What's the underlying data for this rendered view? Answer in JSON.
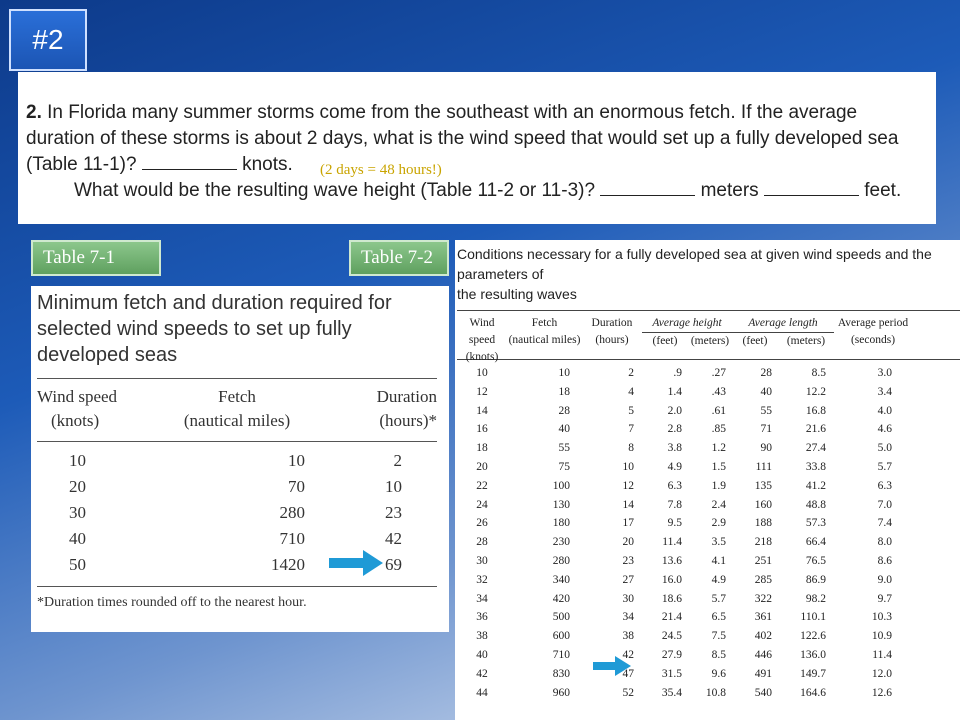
{
  "slide": {
    "number_label": "#2"
  },
  "question": {
    "number": "2.",
    "text_line1": "In Florida many summer storms come from the southeast with an enormous fetch. If the average",
    "text_line2": "duration of these storms is about 2 days, what is the wind speed that would set up a fully developed sea",
    "text_line3a": "(Table 11-1)?",
    "text_line3b": "knots.",
    "text_line4a": "What would be the resulting wave height (Table 11-2 or 11-3)?",
    "text_line4b": "meters",
    "text_line4c": "feet.",
    "note": "(2 days = 48 hours!)",
    "note_color": "#c9a400"
  },
  "table71": {
    "tab_label": "Table 7-1",
    "caption_line1": "Minimum fetch and duration required for",
    "caption_line2": "selected wind speeds to set up fully",
    "caption_line3": "developed seas",
    "headers": [
      [
        "Wind speed",
        "(knots)"
      ],
      [
        "Fetch",
        "(nautical miles)"
      ],
      [
        "Duration",
        "(hours)*"
      ]
    ],
    "rows": [
      [
        "10",
        "10",
        "2"
      ],
      [
        "20",
        "70",
        "10"
      ],
      [
        "30",
        "280",
        "23"
      ],
      [
        "40",
        "710",
        "42"
      ],
      [
        "50",
        "1420",
        "69"
      ]
    ],
    "footnote": "*Duration times rounded off to the nearest hour.",
    "arrow_color": "#1f9ad6"
  },
  "table72": {
    "tab_label": "Table 7-2",
    "caption_line1": "Conditions necessary for a fully developed sea at given wind speeds and the parameters of",
    "caption_line2": "the resulting waves",
    "headers": {
      "wind": [
        "Wind speed",
        "(knots)"
      ],
      "fetch": [
        "Fetch",
        "(nautical miles)"
      ],
      "duration": [
        "Duration",
        "(hours)"
      ],
      "avg_height": "Average height",
      "avg_length": "Average length",
      "feet": "(feet)",
      "meters": "(meters)",
      "period": [
        "Average period",
        "(seconds)"
      ]
    },
    "rows": [
      [
        "10",
        "10",
        "2",
        ".9",
        ".27",
        "28",
        "8.5",
        "3.0"
      ],
      [
        "12",
        "18",
        "4",
        "1.4",
        ".43",
        "40",
        "12.2",
        "3.4"
      ],
      [
        "14",
        "28",
        "5",
        "2.0",
        ".61",
        "55",
        "16.8",
        "4.0"
      ],
      [
        "16",
        "40",
        "7",
        "2.8",
        ".85",
        "71",
        "21.6",
        "4.6"
      ],
      [
        "18",
        "55",
        "8",
        "3.8",
        "1.2",
        "90",
        "27.4",
        "5.0"
      ],
      [
        "20",
        "75",
        "10",
        "4.9",
        "1.5",
        "111",
        "33.8",
        "5.7"
      ],
      [
        "22",
        "100",
        "12",
        "6.3",
        "1.9",
        "135",
        "41.2",
        "6.3"
      ],
      [
        "24",
        "130",
        "14",
        "7.8",
        "2.4",
        "160",
        "48.8",
        "7.0"
      ],
      [
        "26",
        "180",
        "17",
        "9.5",
        "2.9",
        "188",
        "57.3",
        "7.4"
      ],
      [
        "28",
        "230",
        "20",
        "11.4",
        "3.5",
        "218",
        "66.4",
        "8.0"
      ],
      [
        "30",
        "280",
        "23",
        "13.6",
        "4.1",
        "251",
        "76.5",
        "8.6"
      ],
      [
        "32",
        "340",
        "27",
        "16.0",
        "4.9",
        "285",
        "86.9",
        "9.0"
      ],
      [
        "34",
        "420",
        "30",
        "18.6",
        "5.7",
        "322",
        "98.2",
        "9.7"
      ],
      [
        "36",
        "500",
        "34",
        "21.4",
        "6.5",
        "361",
        "110.1",
        "10.3"
      ],
      [
        "38",
        "600",
        "38",
        "24.5",
        "7.5",
        "402",
        "122.6",
        "10.9"
      ],
      [
        "40",
        "710",
        "42",
        "27.9",
        "8.5",
        "446",
        "136.0",
        "11.4"
      ],
      [
        "42",
        "830",
        "47",
        "31.5",
        "9.6",
        "491",
        "149.7",
        "12.0"
      ],
      [
        "44",
        "960",
        "52",
        "35.4",
        "10.8",
        "540",
        "164.6",
        "12.6"
      ]
    ],
    "arrow_color": "#1f9ad6"
  }
}
